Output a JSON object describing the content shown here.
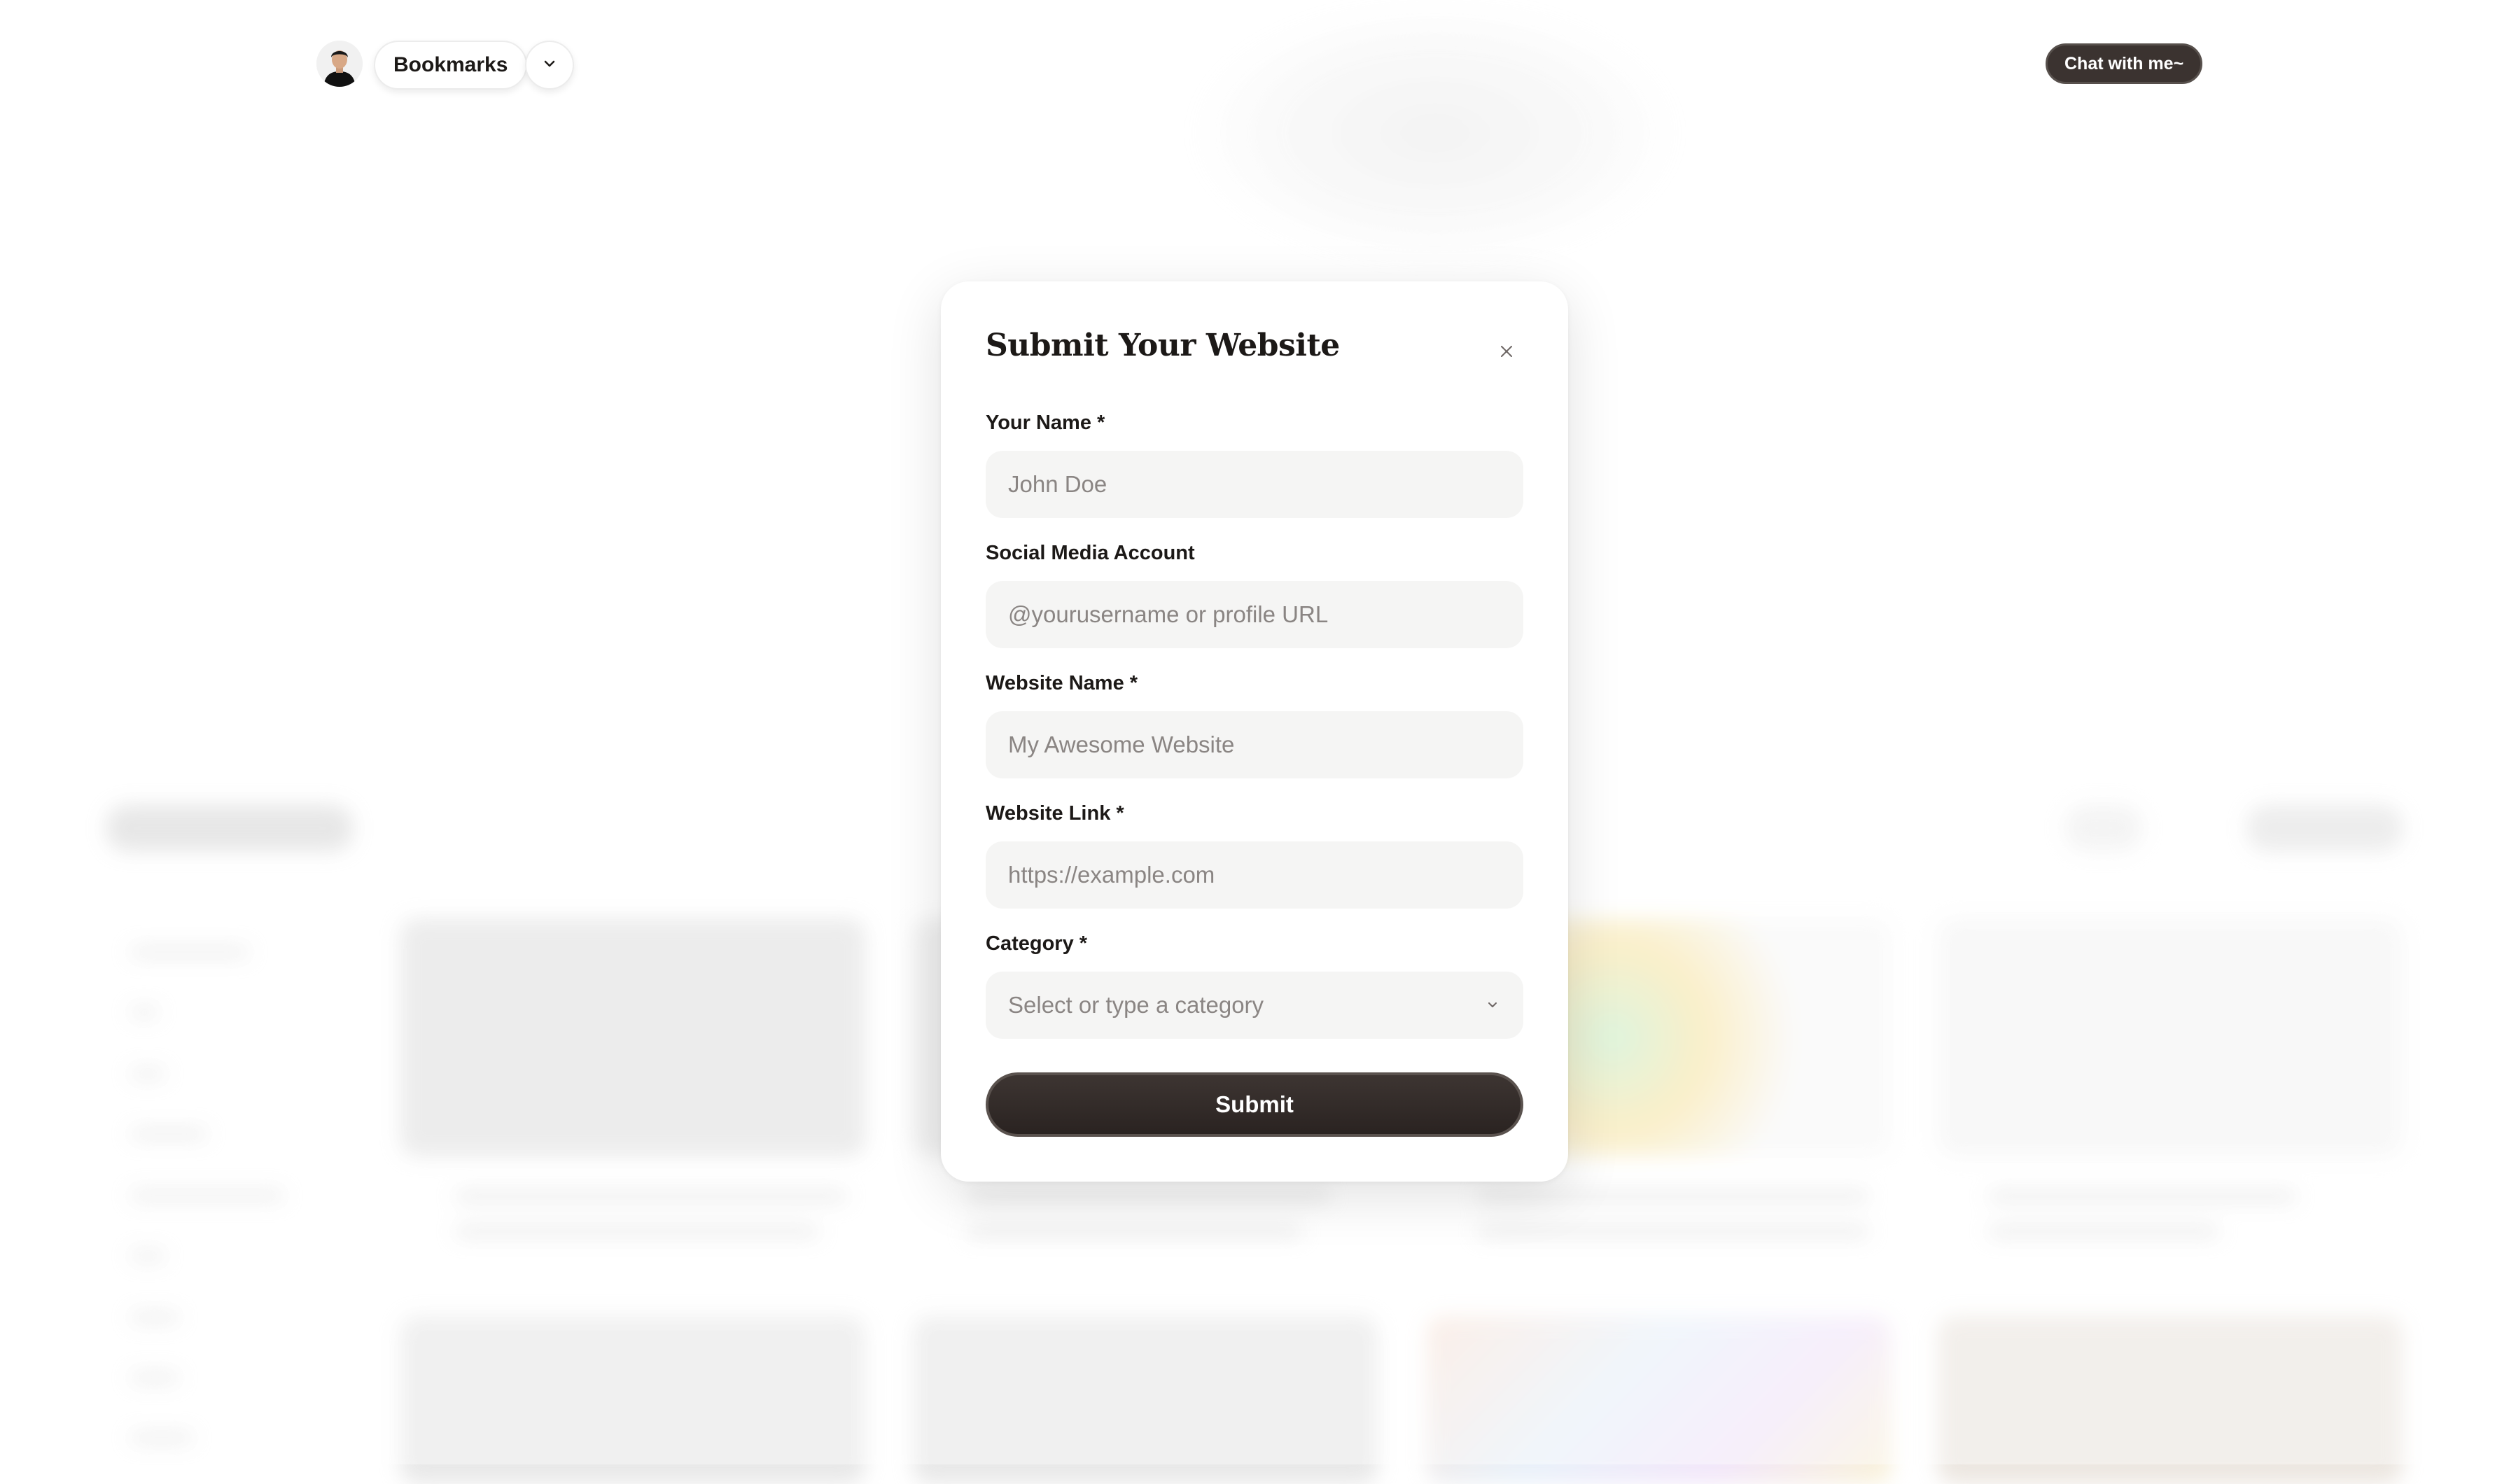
{
  "header": {
    "nav_label": "Bookmarks",
    "chat_label": "Chat with me~"
  },
  "modal": {
    "title": "Submit Your Website",
    "fields": {
      "name": {
        "label": "Your Name *",
        "placeholder": "John Doe"
      },
      "social": {
        "label": "Social Media Account",
        "placeholder": "@yourusername or profile URL"
      },
      "website_name": {
        "label": "Website Name *",
        "placeholder": "My Awesome Website"
      },
      "website_link": {
        "label": "Website Link *",
        "placeholder": "https://example.com"
      },
      "category": {
        "label": "Category *",
        "placeholder": "Select or type a category"
      }
    },
    "submit_label": "Submit"
  },
  "colors": {
    "button_dark": "#3b3330",
    "input_bg": "#f5f5f4",
    "text": "#1c1917",
    "placeholder": "#8a8583"
  },
  "icons": {
    "close": "close-icon",
    "nav_dropdown": "chevron-down-icon",
    "category_dropdown": "chevron-down-icon"
  }
}
